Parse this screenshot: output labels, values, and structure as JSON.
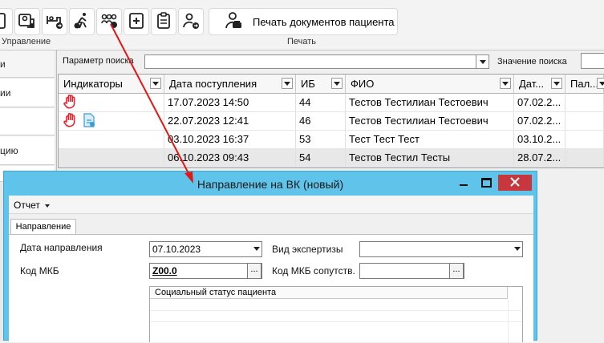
{
  "ribbon": {
    "groups": {
      "manage": "Управление",
      "print": "Печать"
    },
    "buttons": [
      {
        "icon": "patient-edit-icon"
      },
      {
        "icon": "doctor-card-icon"
      },
      {
        "icon": "transfer-bed-icon"
      },
      {
        "icon": "discharge-icon"
      },
      {
        "icon": "people-group-icon"
      },
      {
        "icon": "medical-add-icon"
      },
      {
        "icon": "clipboard-icon"
      },
      {
        "icon": "person-arrow-icon"
      }
    ],
    "print_button_label": "Печать документов пациента"
  },
  "leftnav": {
    "items": [
      "и",
      "ии",
      "",
      "цию",
      ""
    ]
  },
  "search": {
    "param_label": "Параметр поиска",
    "param_value": "",
    "value_label": "Значение поиска"
  },
  "grid": {
    "columns": [
      "Индикаторы",
      "Дата поступления",
      "ИБ",
      "ФИО",
      "Дат...",
      "Пал..."
    ],
    "rows": [
      {
        "indicators": [
          "stop-hand-icon"
        ],
        "date": "17.07.2023 14:50",
        "ib": "44",
        "fio": "Тестов Тестилиан Тестоевич",
        "date2": "07.02.2..."
      },
      {
        "indicators": [
          "stop-hand-icon",
          "document-icon"
        ],
        "date": "22.07.2023 12:41",
        "ib": "46",
        "fio": "Тестов Тестилиан Тестоевич",
        "date2": "07.02.2..."
      },
      {
        "indicators": [],
        "date": "03.10.2023 16:37",
        "ib": "53",
        "fio": "Тест Тест Тест",
        "date2": "03.10.2..."
      },
      {
        "indicators": [],
        "date": "06.10.2023 09:43",
        "ib": "54",
        "fio": "Тестов Тестил Тесты",
        "date2": "28.07.2..."
      }
    ]
  },
  "dialog": {
    "title": "Направление на ВК (новый)",
    "menu_report": "Отчет",
    "tab": "Направление",
    "date_label": "Дата направления",
    "date_value": "07.10.2023",
    "exam_label": "Вид экспертизы",
    "exam_value": "",
    "mkb_label": "Код МКБ",
    "mkb_value": "Z00.0",
    "mkb2_label": "Код МКБ сопутств.",
    "mkb2_value": "",
    "ellipsis": "...",
    "social_header": "Социальный статус пациента"
  },
  "colors": {
    "dialog_title_bg": "#5fc3ea",
    "indicator_red": "#e0252f",
    "annotation_arrow": "#e01818"
  }
}
